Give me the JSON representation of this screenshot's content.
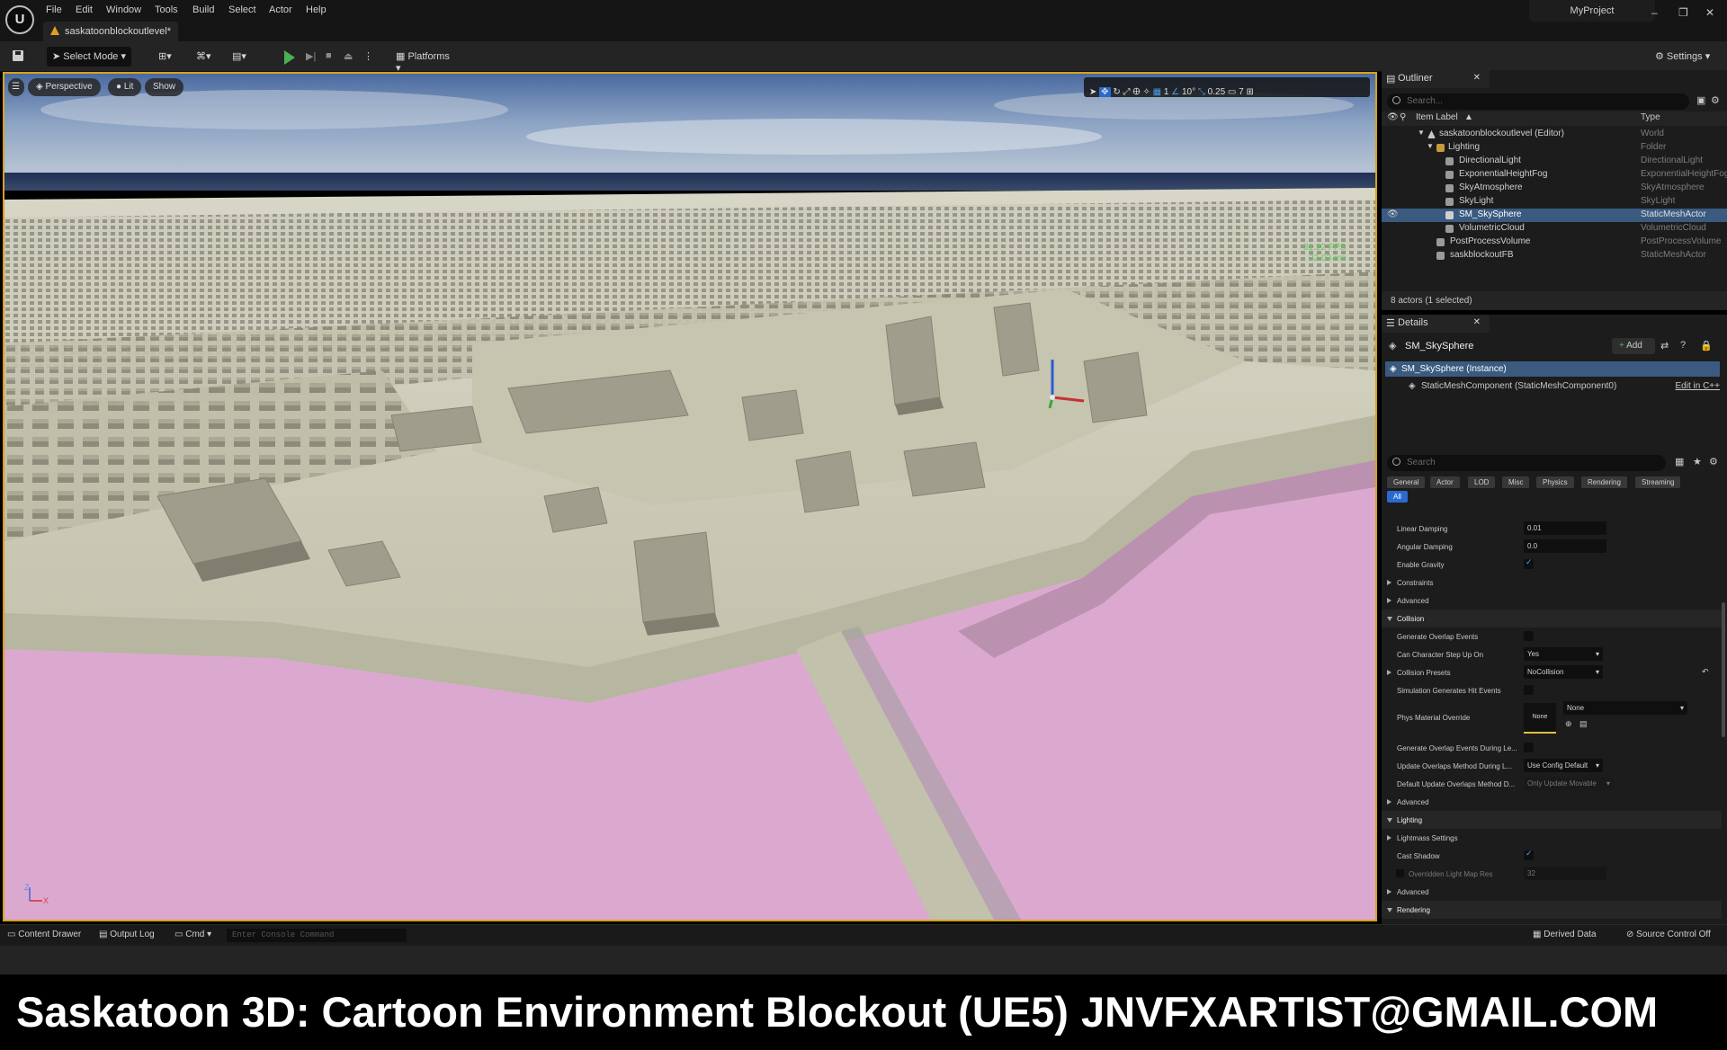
{
  "menubar": {
    "items": [
      "File",
      "Edit",
      "Window",
      "Tools",
      "Build",
      "Select",
      "Actor",
      "Help"
    ],
    "level_tab": "saskatoonblockoutlevel*",
    "project": "MyProject",
    "window_buttons": [
      "–",
      "❐",
      "✕"
    ]
  },
  "toolbar": {
    "mode": "Select Mode",
    "platforms": "Platforms",
    "settings": "Settings"
  },
  "viewport": {
    "view_mode": "Perspective",
    "lighting": "Lit",
    "show": "Show",
    "snap_grid": "1",
    "snap_angle": "10°",
    "snap_scale": "0.25",
    "camera_speed": "7",
    "fps": "31.22 FPS",
    "frame_ms": "32.03 ms",
    "axis_z": "Z",
    "axis_x": "X"
  },
  "outliner": {
    "tab": "Outliner",
    "search_placeholder": "Search...",
    "col_label": "Item Label",
    "col_type": "Type",
    "rows": [
      {
        "label": "saskatoonblockoutlevel (Editor)",
        "type": "World"
      },
      {
        "label": "Lighting",
        "type": "Folder"
      },
      {
        "label": "DirectionalLight",
        "type": "DirectionalLight"
      },
      {
        "label": "ExponentialHeightFog",
        "type": "ExponentialHeightFog"
      },
      {
        "label": "SkyAtmosphere",
        "type": "SkyAtmosphere"
      },
      {
        "label": "SkyLight",
        "type": "SkyLight"
      },
      {
        "label": "SM_SkySphere",
        "type": "StaticMeshActor"
      },
      {
        "label": "VolumetricCloud",
        "type": "VolumetricCloud"
      },
      {
        "label": "PostProcessVolume",
        "type": "PostProcessVolume"
      },
      {
        "label": "saskblockoutFB",
        "type": "StaticMeshActor"
      }
    ],
    "summary": "8 actors (1 selected)"
  },
  "details": {
    "tab": "Details",
    "actor_name": "SM_SkySphere",
    "add_label": "Add",
    "instance": "SM_SkySphere (Instance)",
    "component": "StaticMeshComponent (StaticMeshComponent0)",
    "edit_cpp": "Edit in C++",
    "search_placeholder": "Search",
    "categories": [
      "General",
      "Actor",
      "LOD",
      "Misc",
      "Physics",
      "Rendering",
      "Streaming"
    ],
    "all_label": "All",
    "props": {
      "linear_damping_label": "Linear Damping",
      "linear_damping": "0.01",
      "angular_damping_label": "Angular Damping",
      "angular_damping": "0.0",
      "enable_gravity_label": "Enable Gravity",
      "constraints": "Constraints",
      "advanced": "Advanced",
      "collision": "Collision",
      "gen_overlap": "Generate Overlap Events",
      "step_up_label": "Can Character Step Up On",
      "step_up": "Yes",
      "presets_label": "Collision Presets",
      "presets": "NoCollision",
      "sim_hit": "Simulation Generates Hit Events",
      "phys_mat_label": "Phys Material Override",
      "phys_mat_thumb": "None",
      "phys_mat": "None",
      "gen_overlap_level": "Generate Overlap Events During Le...",
      "update_overlaps_label": "Update Overlaps Method During L...",
      "update_overlaps": "Use Config Default",
      "default_update_label": "Default Update Overlaps Method D...",
      "default_update": "Only Update Movable",
      "lighting": "Lighting",
      "lightmass": "Lightmass Settings",
      "cast_shadow": "Cast Shadow",
      "overridden_lmr_label": "Overridden Light Map Res",
      "overridden_lmr": "32",
      "rendering": "Rendering"
    }
  },
  "statusbar": {
    "content_drawer": "Content Drawer",
    "output_log": "Output Log",
    "cmd": "Cmd",
    "console_placeholder": "Enter Console Command",
    "derived_data": "Derived Data",
    "source_control": "Source Control Off"
  },
  "caption": {
    "title": "Saskatoon 3D: Cartoon Environment Blockout (UE5)",
    "email": "JNVFXARTIST@GMAIL.COM"
  },
  "colors": {
    "accent_yellow": "#d7a31c",
    "selection": "#3a5a80",
    "ground": "#bdbca5",
    "water": "#dba9cf"
  }
}
